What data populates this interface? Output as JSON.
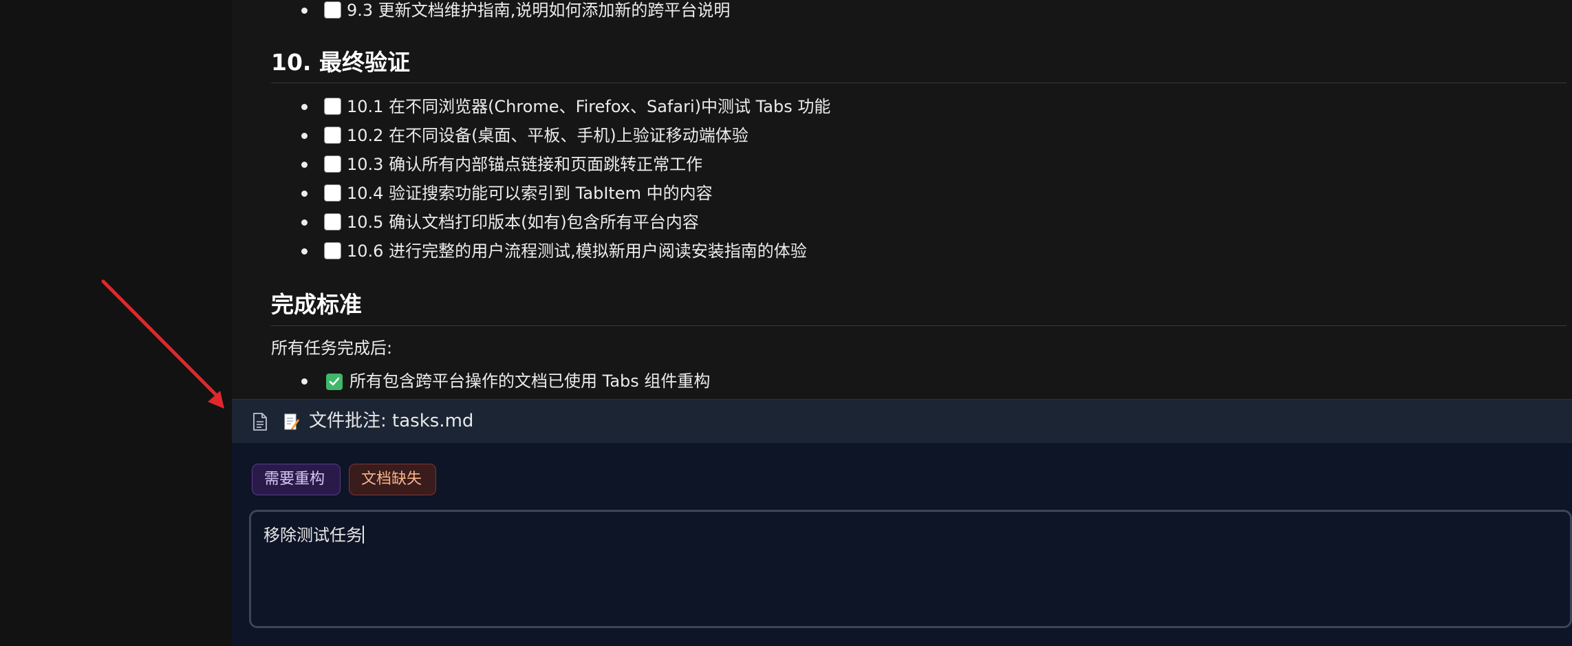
{
  "content": {
    "task_9_3": "9.3 更新文档维护指南,说明如何添加新的跨平台说明",
    "section_10_heading": "10. 最终验证",
    "section_10_tasks": [
      "10.1 在不同浏览器(Chrome、Firefox、Safari)中测试 Tabs 功能",
      "10.2 在不同设备(桌面、平板、手机)上验证移动端体验",
      "10.3 确认所有内部锚点链接和页面跳转正常工作",
      "10.4 验证搜索功能可以索引到 TabItem 中的内容",
      "10.5 确认文档打印版本(如有)包含所有平台内容",
      "10.6 进行完整的用户流程测试,模拟新用户阅读安装指南的体验"
    ],
    "completion_heading": "完成标准",
    "completion_intro": "所有任务完成后:",
    "completion_item_1": "所有包含跨平台操作的文档已使用 Tabs 组件重构"
  },
  "annotation": {
    "title": "文件批注: tasks.md",
    "tags": [
      "需要重构",
      "文档缺失"
    ],
    "comment_value": "移除测试任务"
  },
  "icons": {
    "doc": "document-icon",
    "memo": "memo-icon",
    "checkbox_checked": "checkmark-icon"
  },
  "colors": {
    "accent_arrow": "#e0282d",
    "check_green": "#3fb86a",
    "tag_purple": "#5a3a8c",
    "tag_red": "#7a3838"
  }
}
